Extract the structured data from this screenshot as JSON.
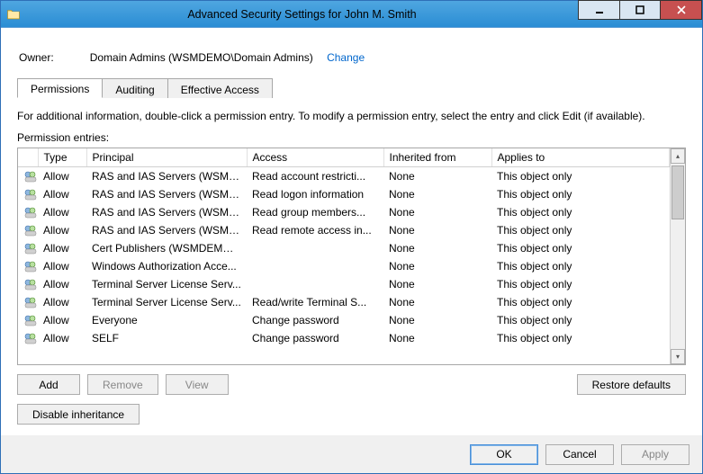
{
  "window": {
    "title": "Advanced Security Settings for John M. Smith"
  },
  "owner": {
    "label": "Owner:",
    "value": "Domain Admins (WSMDEMO\\Domain Admins)",
    "change": "Change"
  },
  "tabs": {
    "permissions": "Permissions",
    "auditing": "Auditing",
    "effective": "Effective Access"
  },
  "info_text": "For additional information, double-click a permission entry. To modify a permission entry, select the entry and click Edit (if available).",
  "list_label": "Permission entries:",
  "columns": {
    "icon": "",
    "type": "Type",
    "principal": "Principal",
    "access": "Access",
    "inherited": "Inherited from",
    "applies": "Applies to"
  },
  "entries": [
    {
      "type": "Allow",
      "principal": "RAS and IAS Servers (WSMDE...",
      "access": "Read account restricti...",
      "inherited": "None",
      "applies": "This object only"
    },
    {
      "type": "Allow",
      "principal": "RAS and IAS Servers (WSMDE...",
      "access": "Read logon information",
      "inherited": "None",
      "applies": "This object only"
    },
    {
      "type": "Allow",
      "principal": "RAS and IAS Servers (WSMDE...",
      "access": "Read group members...",
      "inherited": "None",
      "applies": "This object only"
    },
    {
      "type": "Allow",
      "principal": "RAS and IAS Servers (WSMDE...",
      "access": "Read remote access in...",
      "inherited": "None",
      "applies": "This object only"
    },
    {
      "type": "Allow",
      "principal": "Cert Publishers (WSMDEMO\\...",
      "access": "",
      "inherited": "None",
      "applies": "This object only"
    },
    {
      "type": "Allow",
      "principal": "Windows Authorization Acce...",
      "access": "",
      "inherited": "None",
      "applies": "This object only"
    },
    {
      "type": "Allow",
      "principal": "Terminal Server License Serv...",
      "access": "",
      "inherited": "None",
      "applies": "This object only"
    },
    {
      "type": "Allow",
      "principal": "Terminal Server License Serv...",
      "access": "Read/write Terminal S...",
      "inherited": "None",
      "applies": "This object only"
    },
    {
      "type": "Allow",
      "principal": "Everyone",
      "access": "Change password",
      "inherited": "None",
      "applies": "This object only"
    },
    {
      "type": "Allow",
      "principal": "SELF",
      "access": "Change password",
      "inherited": "None",
      "applies": "This object only"
    }
  ],
  "buttons": {
    "add": "Add",
    "remove": "Remove",
    "view": "View",
    "restore": "Restore defaults",
    "disable_inh": "Disable inheritance",
    "ok": "OK",
    "cancel": "Cancel",
    "apply": "Apply"
  }
}
